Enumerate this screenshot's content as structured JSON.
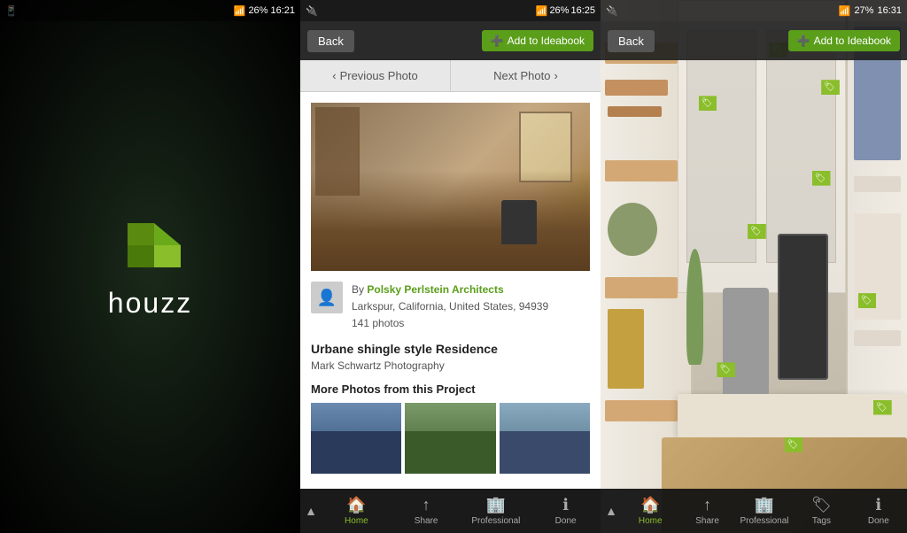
{
  "panel1": {
    "status_time": "16:21",
    "logo_text": "houzz"
  },
  "panel2": {
    "status_time": "16:25",
    "back_label": "Back",
    "add_ideabook_label": "Add to Ideabook",
    "prev_photo_label": "Previous Photo",
    "next_photo_label": "Next Photo",
    "meta_by": "By",
    "architect_name": "Polsky Perlstein Architects",
    "location": "Larkspur, California, United States, 94939",
    "photo_count": "141 photos",
    "project_title": "Urbane shingle style Residence",
    "photographer": "Mark Schwartz Photography",
    "more_photos_label": "More Photos from this Project",
    "bottom_home": "Home",
    "bottom_share": "Share",
    "bottom_professional": "Professional",
    "bottom_done": "Done"
  },
  "panel3": {
    "status_time": "16:31",
    "back_label": "Back",
    "add_ideabook_label": "Add to Ideabook",
    "bottom_home": "Home",
    "bottom_share": "Share",
    "bottom_professional": "Professional",
    "bottom_tags": "Tags",
    "bottom_done": "Done"
  }
}
